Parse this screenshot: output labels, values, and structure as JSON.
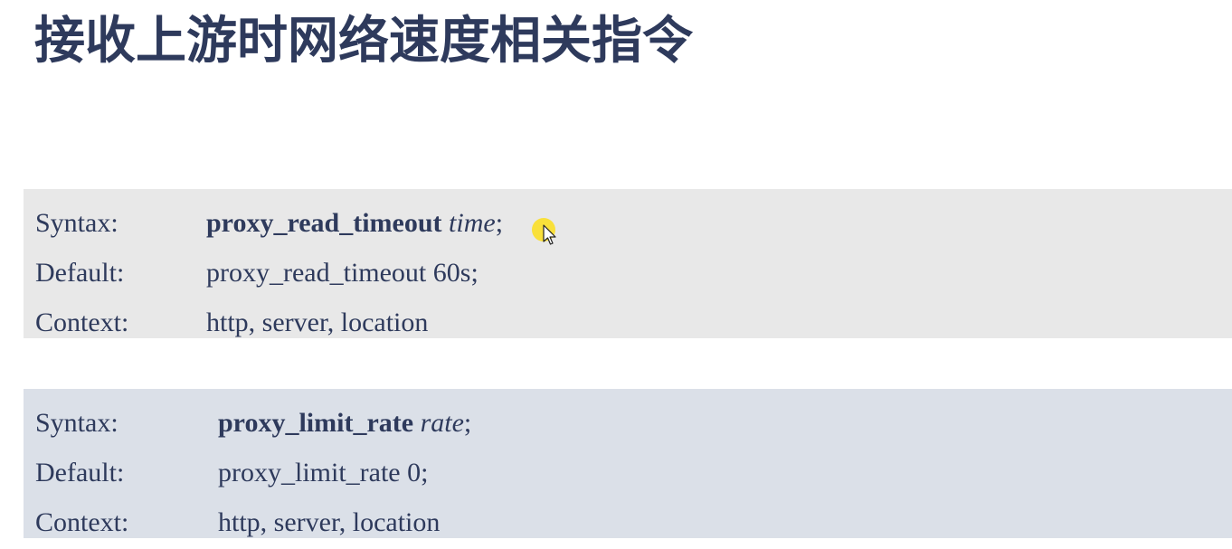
{
  "title": "接收上游时网络速度相关指令",
  "directives": [
    {
      "syntax_label": "Syntax:",
      "syntax_keyword": "proxy_read_timeout",
      "syntax_arg": "time",
      "syntax_end": ";",
      "default_label": "Default:",
      "default_value": "proxy_read_timeout 60s;",
      "context_label": "Context:",
      "context_value": "http, server, location"
    },
    {
      "syntax_label": "Syntax:",
      "syntax_keyword": "proxy_limit_rate",
      "syntax_arg": "rate",
      "syntax_end": ";",
      "default_label": "Default:",
      "default_value": "proxy_limit_rate 0;",
      "context_label": "Context:",
      "context_value": "http, server, location"
    }
  ],
  "colors": {
    "text": "#2e3a5c",
    "box_1_bg": "#e8e8e8",
    "box_2_bg": "#dbe0e8",
    "cursor_highlight": "#ffde00"
  },
  "icons": {
    "cursor": "mouse-pointer-icon"
  }
}
